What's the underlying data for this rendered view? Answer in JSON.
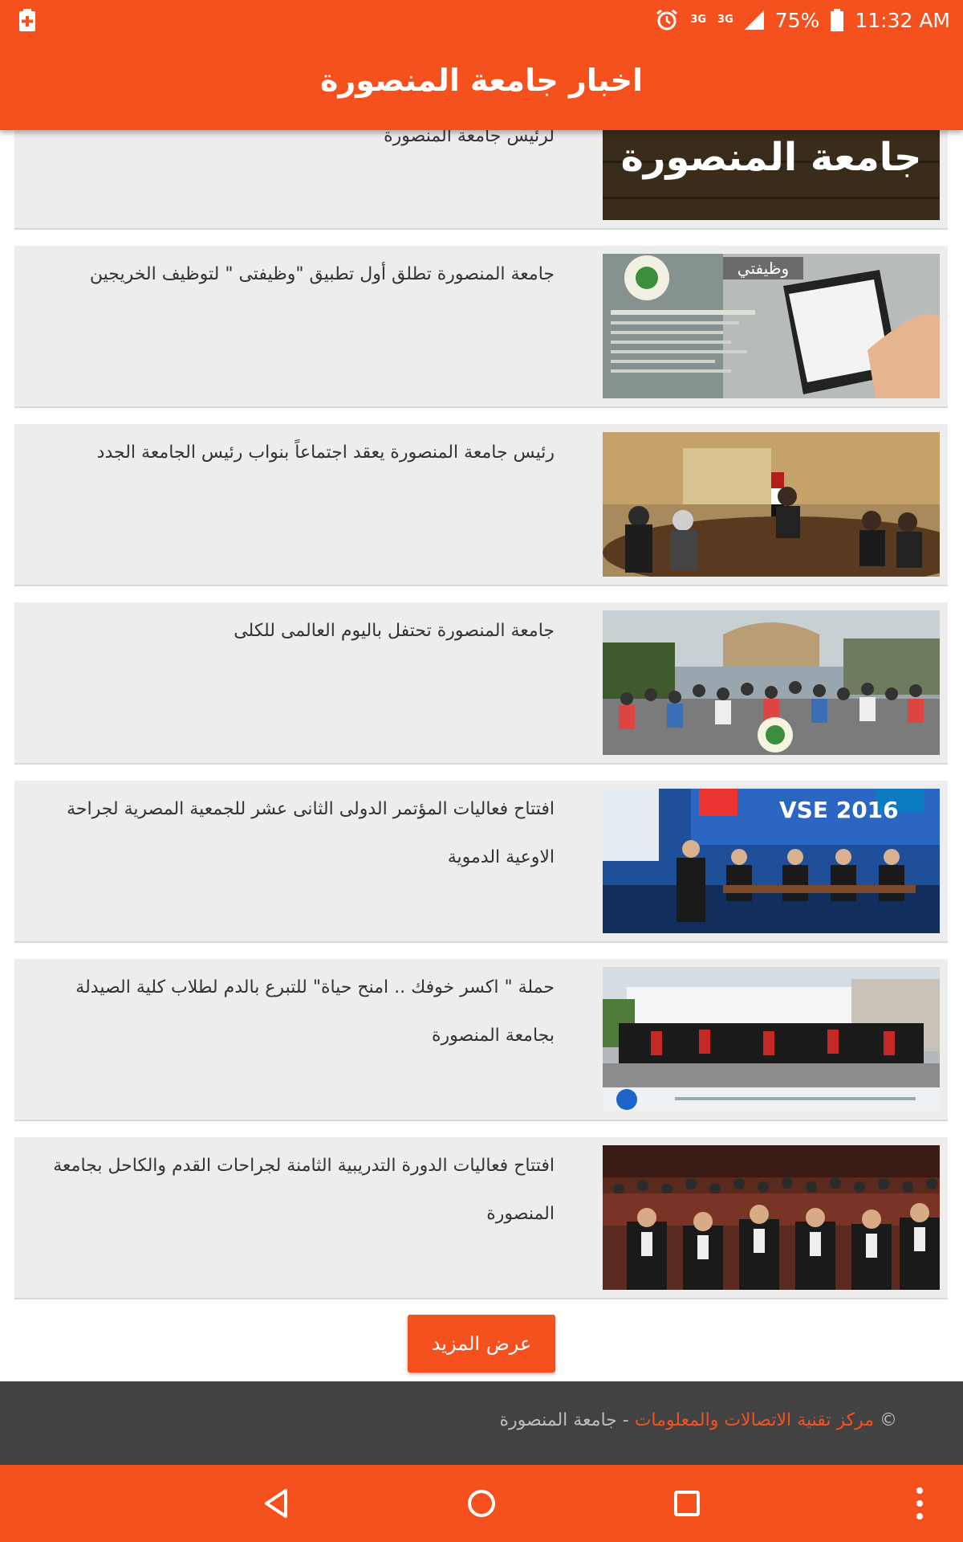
{
  "status_bar": {
    "network_1": "3G",
    "network_2": "3G",
    "battery_percent": "75%",
    "time": "11:32 AM"
  },
  "app_bar": {
    "title": "اخبار جامعة المنصورة"
  },
  "news": [
    {
      "title": "لرئيس جامعة المنصورة",
      "thumb_text": "جامعة المنصورة"
    },
    {
      "title": "جامعة المنصورة تطلق أول تطبيق \"وظيفتى \" لتوظيف الخريجين",
      "thumb_text": "وظيفتي"
    },
    {
      "title": "رئيس جامعة المنصورة يعقد اجتماعاً بنواب رئيس الجامعة الجدد"
    },
    {
      "title": "جامعة المنصورة تحتفل باليوم العالمى للكلى"
    },
    {
      "title": "افتتاح فعاليات المؤتمر الدولى الثانى عشر للجمعية المصرية لجراحة الاوعية الدموية",
      "thumb_text": "VSE 2016"
    },
    {
      "title": "حملة \" اكسر خوفك .. امنح حياة\" للتبرع بالدم لطلاب كلية الصيدلة بجامعة المنصورة"
    },
    {
      "title": "افتتاح فعاليات الدورة التدريبية الثامنة لجراحات القدم والكاحل بجامعة المنصورة"
    }
  ],
  "more_button": "عرض المزيد",
  "footer": {
    "copyright": "©",
    "link": "مركز تقنية الاتصالات والمعلومات",
    "suffix": " - جامعة المنصورة"
  },
  "colors": {
    "primary": "#f4511e",
    "card_bg": "#ededed",
    "footer_bg": "#424242"
  }
}
